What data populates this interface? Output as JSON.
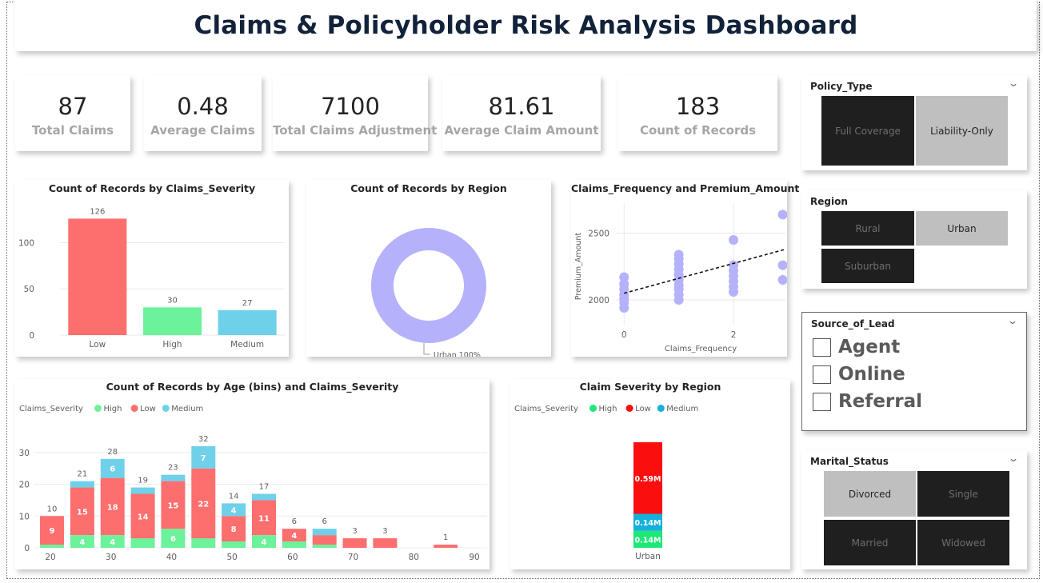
{
  "dashboard": {
    "title": "Claims & Policyholder Risk Analysis Dashboard"
  },
  "kpis": [
    {
      "value": "87",
      "label": "Total Claims"
    },
    {
      "value": "0.48",
      "label": "Average Claims"
    },
    {
      "value": "7100",
      "label": "Total Claims Adjustment"
    },
    {
      "value": "81.61",
      "label": "Average Claim Amount"
    },
    {
      "value": "183",
      "label": "Count of Records"
    }
  ],
  "slicers": {
    "policy_type": {
      "title": "Policy_Type",
      "options": [
        {
          "label": "Full Coverage",
          "selected": false
        },
        {
          "label": "Liability-Only",
          "selected": true
        }
      ]
    },
    "region": {
      "title": "Region",
      "options": [
        {
          "label": "Rural",
          "selected": false
        },
        {
          "label": "Urban",
          "selected": true
        },
        {
          "label": "Suburban",
          "selected": false
        }
      ]
    },
    "source_of_lead": {
      "title": "Source_of_Lead",
      "options": [
        {
          "label": "Agent",
          "checked": false
        },
        {
          "label": "Online",
          "checked": false
        },
        {
          "label": "Referral",
          "checked": false
        }
      ]
    },
    "marital_status": {
      "title": "Marital_Status",
      "options": [
        {
          "label": "Divorced",
          "selected": true
        },
        {
          "label": "Single",
          "selected": false
        },
        {
          "label": "Married",
          "selected": false
        },
        {
          "label": "Widowed",
          "selected": false
        }
      ]
    }
  },
  "colors": {
    "high": "#6cf29a",
    "low": "#fd6e6e",
    "medium": "#6fd0ea",
    "donut": "#b5b2fb",
    "title": "#12223a",
    "high_bright": "#1de876",
    "low_bright": "#fa0e0e",
    "medium_bright": "#15b0dc"
  },
  "chart_data": [
    {
      "id": "severity",
      "type": "bar",
      "title": "Count of Records by Claims_Severity",
      "categories": [
        "Low",
        "High",
        "Medium"
      ],
      "values": [
        126,
        30,
        27
      ],
      "colors": [
        "#fd6e6e",
        "#6cf29a",
        "#6fd0ea"
      ],
      "yticks": [
        0,
        50,
        100
      ],
      "ylim": [
        0,
        135
      ]
    },
    {
      "id": "region",
      "type": "pie",
      "title": "Count of Records by Region",
      "slices": [
        {
          "label": "Urban",
          "value": 100,
          "display": "Urban 100%"
        }
      ]
    },
    {
      "id": "freq_premium",
      "type": "scatter",
      "title": "Claims_Frequency and Premium_Amount",
      "xlabel": "Claims_Frequency",
      "ylabel": "Premium_Amount",
      "xticks": [
        0,
        2
      ],
      "yticks": [
        2000,
        2500
      ],
      "xlim": [
        -0.15,
        2.95
      ],
      "ylim": [
        1880,
        2720
      ],
      "points": [
        [
          0,
          1940
        ],
        [
          0,
          1980
        ],
        [
          0,
          2010
        ],
        [
          0,
          2040
        ],
        [
          0,
          2080
        ],
        [
          0,
          2120
        ],
        [
          0,
          2170
        ],
        [
          1,
          2000
        ],
        [
          1,
          2040
        ],
        [
          1,
          2080
        ],
        [
          1,
          2110
        ],
        [
          1,
          2150
        ],
        [
          1,
          2190
        ],
        [
          1,
          2230
        ],
        [
          1,
          2270
        ],
        [
          1,
          2310
        ],
        [
          1,
          2340
        ],
        [
          2,
          2060
        ],
        [
          2,
          2100
        ],
        [
          2,
          2140
        ],
        [
          2,
          2180
        ],
        [
          2,
          2220
        ],
        [
          2,
          2260
        ],
        [
          2,
          2450
        ],
        [
          2.9,
          2150
        ],
        [
          2.9,
          2260
        ],
        [
          2.9,
          2640
        ]
      ],
      "trend": [
        [
          0,
          2050
        ],
        [
          2.95,
          2380
        ]
      ]
    },
    {
      "id": "age_severity",
      "type": "bar",
      "title": "Count of Records by Age (bins) and Claims_Severity",
      "legend_title": "Claims_Severity",
      "series_names": [
        "High",
        "Low",
        "Medium"
      ],
      "xticks": [
        20,
        30,
        40,
        50,
        60,
        70,
        80,
        90
      ],
      "yticks": [
        0,
        10,
        20,
        30
      ],
      "ylim": [
        0,
        34
      ],
      "bins": [
        {
          "x": 20,
          "high": 1,
          "low": 9,
          "medium": 0,
          "total": 10,
          "labels": {
            "low": "9"
          }
        },
        {
          "x": 25,
          "high": 4,
          "low": 15,
          "medium": 2,
          "total": 21,
          "labels": {
            "high": "4",
            "low": "15"
          }
        },
        {
          "x": 30,
          "high": 4,
          "low": 18,
          "medium": 6,
          "total": 28,
          "labels": {
            "high": "4",
            "low": "18",
            "medium": "6"
          }
        },
        {
          "x": 35,
          "high": 3,
          "low": 14,
          "medium": 2,
          "total": 19,
          "labels": {
            "low": "14"
          }
        },
        {
          "x": 40,
          "high": 6,
          "low": 15,
          "medium": 2,
          "total": 23,
          "labels": {
            "high": "6",
            "low": "15"
          }
        },
        {
          "x": 45,
          "high": 3,
          "low": 22,
          "medium": 7,
          "total": 32,
          "labels": {
            "low": "22",
            "medium": "7"
          }
        },
        {
          "x": 50,
          "high": 2,
          "low": 8,
          "medium": 4,
          "total": 14,
          "labels": {
            "low": "8",
            "medium": "4"
          }
        },
        {
          "x": 55,
          "high": 4,
          "low": 11,
          "medium": 2,
          "total": 17,
          "labels": {
            "high": "4",
            "low": "11"
          }
        },
        {
          "x": 60,
          "high": 2,
          "low": 4,
          "medium": 0,
          "total": 6,
          "labels": {
            "low": "4"
          }
        },
        {
          "x": 65,
          "high": 1,
          "low": 3,
          "medium": 2,
          "total": 6,
          "labels": {}
        },
        {
          "x": 70,
          "high": 0,
          "low": 3,
          "medium": 0,
          "total": 3,
          "labels": {}
        },
        {
          "x": 75,
          "high": 0,
          "low": 3,
          "medium": 0,
          "total": 3,
          "labels": {}
        },
        {
          "x": 85,
          "high": 0,
          "low": 1,
          "medium": 0,
          "total": 1,
          "labels": {}
        }
      ]
    },
    {
      "id": "severity_region",
      "type": "bar",
      "title": "Claim Severity  by Region",
      "legend_title": "Claims_Severity",
      "series_names": [
        "High",
        "Low",
        "Medium"
      ],
      "categories": [
        "Urban"
      ],
      "stack": [
        {
          "name": "High",
          "value": 0.14,
          "label": "0.14M"
        },
        {
          "name": "Medium",
          "value": 0.14,
          "label": "0.14M"
        },
        {
          "name": "Low",
          "value": 0.59,
          "label": "0.59M"
        }
      ]
    }
  ]
}
